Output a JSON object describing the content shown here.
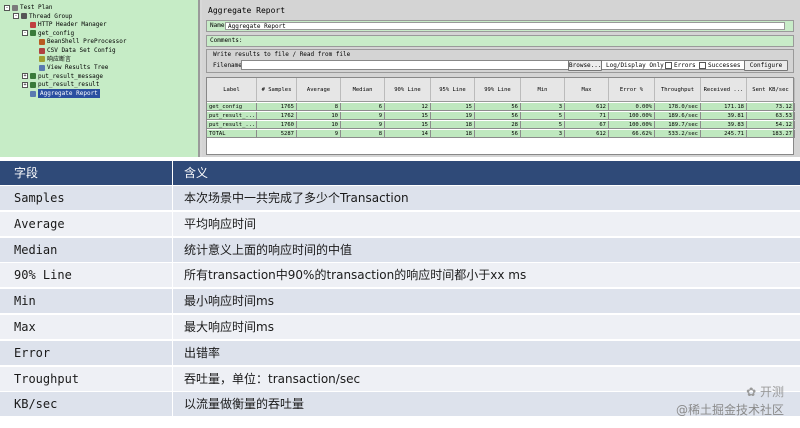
{
  "tree": {
    "items": [
      {
        "label": "Test Plan",
        "depth": 0,
        "toggle": "-",
        "icon": "test-plan-icon",
        "color": "#7a7a7a"
      },
      {
        "label": "Thread Group",
        "depth": 1,
        "toggle": "-",
        "icon": "thread-group-icon",
        "color": "#555555"
      },
      {
        "label": "HTTP Header Manager",
        "depth": 2,
        "toggle": "",
        "icon": "header-manager-icon",
        "color": "#c04040"
      },
      {
        "label": "get_config",
        "depth": 2,
        "toggle": "-",
        "icon": "sampler-icon",
        "color": "#3a7a3a"
      },
      {
        "label": "BeanShell PreProcessor",
        "depth": 3,
        "toggle": "",
        "icon": "preprocessor-icon",
        "color": "#b85a20"
      },
      {
        "label": "CSV Data Set Config",
        "depth": 3,
        "toggle": "",
        "icon": "csv-config-icon",
        "color": "#b04040"
      },
      {
        "label": "响应断言",
        "depth": 3,
        "toggle": "",
        "icon": "assertion-icon",
        "color": "#a0a030"
      },
      {
        "label": "View Results Tree",
        "depth": 3,
        "toggle": "",
        "icon": "results-tree-icon",
        "color": "#5a7ab0"
      },
      {
        "label": "put_result_message",
        "depth": 2,
        "toggle": "+",
        "icon": "sampler-icon",
        "color": "#3a7a3a"
      },
      {
        "label": "put_result_result",
        "depth": 2,
        "toggle": "+",
        "icon": "sampler-icon",
        "color": "#3a7a3a"
      },
      {
        "label": "Aggregate Report",
        "depth": 2,
        "toggle": "",
        "icon": "report-icon",
        "color": "#5a7ab0",
        "selected": true
      }
    ]
  },
  "panel": {
    "title": "Aggregate Report",
    "name_label": "Name:",
    "name_value": "Aggregate Report",
    "comments_label": "Comments:",
    "write_title": "Write results to file / Read from file",
    "filename_label": "Filename",
    "browse": "Browse...",
    "log_only": "Log/Display Only:",
    "errors": "Errors",
    "successes": "Successes",
    "configure": "Configure"
  },
  "report": {
    "columns": [
      "Label",
      "# Samples",
      "Average",
      "Median",
      "90% Line",
      "95% Line",
      "99% Line",
      "Min",
      "Max",
      "Error %",
      "Throughput",
      "Received ...",
      "Sent KB/sec"
    ],
    "rows": [
      [
        "get_config",
        "1765",
        "8",
        "6",
        "12",
        "15",
        "56",
        "3",
        "612",
        "0.00%",
        "178.0/sec",
        "171.18",
        "73.12"
      ],
      [
        "put_result_...",
        "1762",
        "10",
        "9",
        "15",
        "19",
        "56",
        "5",
        "71",
        "100.00%",
        "189.6/sec",
        "39.81",
        "63.53"
      ],
      [
        "put_result_...",
        "1760",
        "10",
        "9",
        "15",
        "18",
        "28",
        "5",
        "67",
        "100.00%",
        "189.7/sec",
        "39.83",
        "54.12"
      ],
      [
        "TOTAL",
        "5287",
        "9",
        "8",
        "14",
        "18",
        "56",
        "3",
        "612",
        "66.62%",
        "533.2/sec",
        "245.71",
        "183.27"
      ]
    ]
  },
  "definitions": {
    "header": [
      "字段",
      "含义"
    ],
    "rows": [
      [
        "Samples",
        "本次场景中一共完成了多少个Transaction"
      ],
      [
        "Average",
        "平均响应时间"
      ],
      [
        "Median",
        "统计意义上面的响应时间的中值"
      ],
      [
        "90% Line",
        "所有transaction中90%的transaction的响应时间都小于xx ms"
      ],
      [
        "Min",
        "最小响应时间ms"
      ],
      [
        "Max",
        "最大响应时间ms"
      ],
      [
        "Error",
        "出错率"
      ],
      [
        "Troughput",
        "吞吐量，单位：transaction/sec"
      ],
      [
        "KB/sec",
        "以流量做衡量的吞吐量"
      ]
    ]
  },
  "watermark": {
    "brand": "开测",
    "site": "@稀土掘金技术社区"
  }
}
